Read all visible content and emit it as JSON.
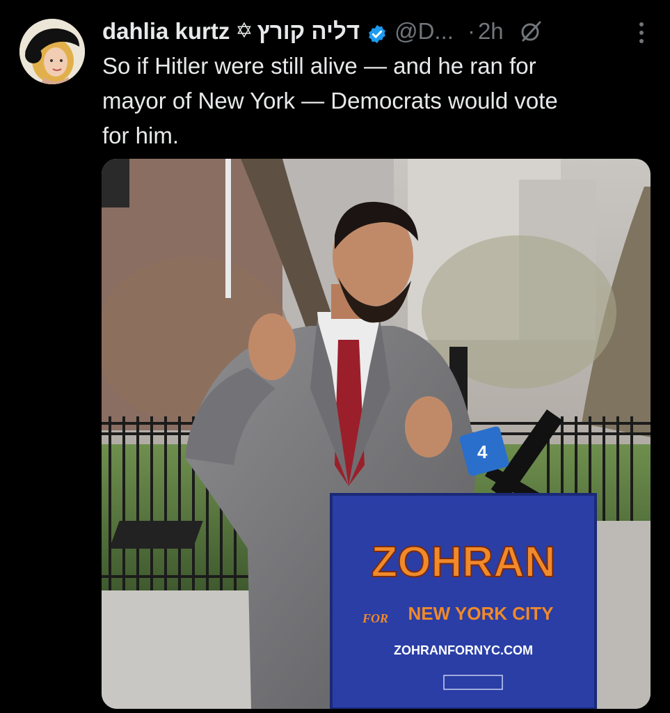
{
  "author": {
    "name": "dahlia kurtz",
    "symbol": "✡",
    "hebrew_name": "דליה קורץ",
    "handle": "@D...",
    "time": "2h"
  },
  "tweet": {
    "text": "So if Hitler were still alive — and he ran for\nmayor of New York — Democrats would vote\nfor him."
  },
  "media": {
    "podium": {
      "headline": "ZOHRAN",
      "for_label": "FOR",
      "city_label": "NEW YORK CITY",
      "website": "ZOHRANFORNYC.COM"
    },
    "mic_flag": "4"
  },
  "icons": {
    "verified": "verified-badge-icon",
    "grok": "grok-icon",
    "more": "more-vertical-icon"
  },
  "colors": {
    "background": "#000000",
    "text_primary": "#e7e9ea",
    "text_secondary": "#71767b",
    "verified_blue": "#1d9bf0",
    "podium_blue": "#2a3ea6",
    "podium_orange": "#f08a2a"
  }
}
